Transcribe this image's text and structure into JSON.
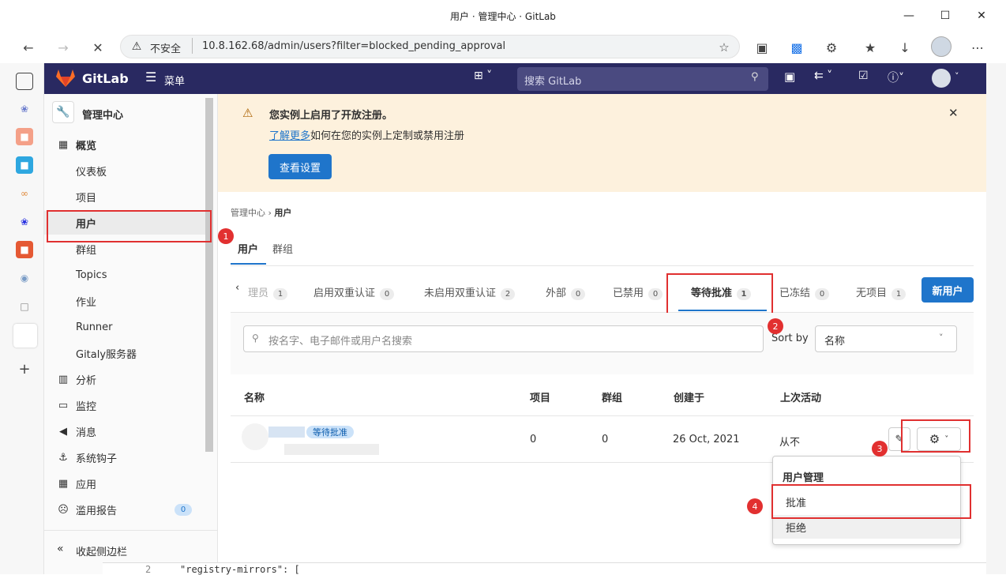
{
  "window": {
    "title": "用户 · 管理中心 · GitLab"
  },
  "browser": {
    "security_label": "不安全",
    "url": "10.8.162.68/admin/users?filter=blocked_pending_approval"
  },
  "gitlab": {
    "brand": "GitLab",
    "menu_label": "菜单",
    "search_placeholder": "搜索 GitLab"
  },
  "sidebar": {
    "header": "管理中心",
    "items": [
      {
        "label": "概览",
        "icon": "grid-icon"
      },
      {
        "label": "仪表板"
      },
      {
        "label": "项目"
      },
      {
        "label": "用户"
      },
      {
        "label": "群组"
      },
      {
        "label": "Topics"
      },
      {
        "label": "作业"
      },
      {
        "label": "Runner"
      },
      {
        "label": "Gitaly服务器"
      },
      {
        "label": "分析",
        "icon": "chart-icon"
      },
      {
        "label": "监控",
        "icon": "monitor-icon"
      },
      {
        "label": "消息",
        "icon": "megaphone-icon"
      },
      {
        "label": "系统钩子",
        "icon": "hook-icon"
      },
      {
        "label": "应用",
        "icon": "apps-icon"
      },
      {
        "label": "滥用报告",
        "icon": "face-icon",
        "count": "0"
      }
    ],
    "collapse_label": "收起侧边栏"
  },
  "alert": {
    "title": "您实例上启用了开放注册。",
    "link_text": "了解更多",
    "text": "如何在您的实例上定制或禁用注册",
    "button": "查看设置"
  },
  "breadcrumb": {
    "root": "管理中心",
    "current": "用户"
  },
  "top_tabs": [
    "用户",
    "群组"
  ],
  "filter_tabs": [
    {
      "label": "理员",
      "count": "1"
    },
    {
      "label": "启用双重认证",
      "count": "0"
    },
    {
      "label": "未启用双重认证",
      "count": "2"
    },
    {
      "label": "外部",
      "count": "0"
    },
    {
      "label": "已禁用",
      "count": "0"
    },
    {
      "label": "等待批准",
      "count": "1"
    },
    {
      "label": "已冻结",
      "count": "0"
    },
    {
      "label": "无项目",
      "count": "1"
    }
  ],
  "new_user_button": "新用户",
  "search": {
    "placeholder": "按名字、电子邮件或用户名搜索",
    "sort_label": "Sort by",
    "sort_value": "名称"
  },
  "table": {
    "headers": [
      "名称",
      "项目",
      "群组",
      "创建于",
      "上次活动"
    ],
    "row": {
      "badge": "等待批准",
      "projects": "0",
      "groups": "0",
      "created": "26 Oct, 2021",
      "last_activity": "从不"
    }
  },
  "dropdown": {
    "header": "用户管理",
    "approve": "批准",
    "reject": "拒绝"
  },
  "annotations": [
    "1",
    "2",
    "3",
    "4"
  ],
  "bottom_code": "\"registry-mirrors\": [",
  "colors": {
    "accent": "#1f75cb",
    "red": "#e03030",
    "header": "#292961",
    "alert_bg": "#fdf1dd"
  }
}
